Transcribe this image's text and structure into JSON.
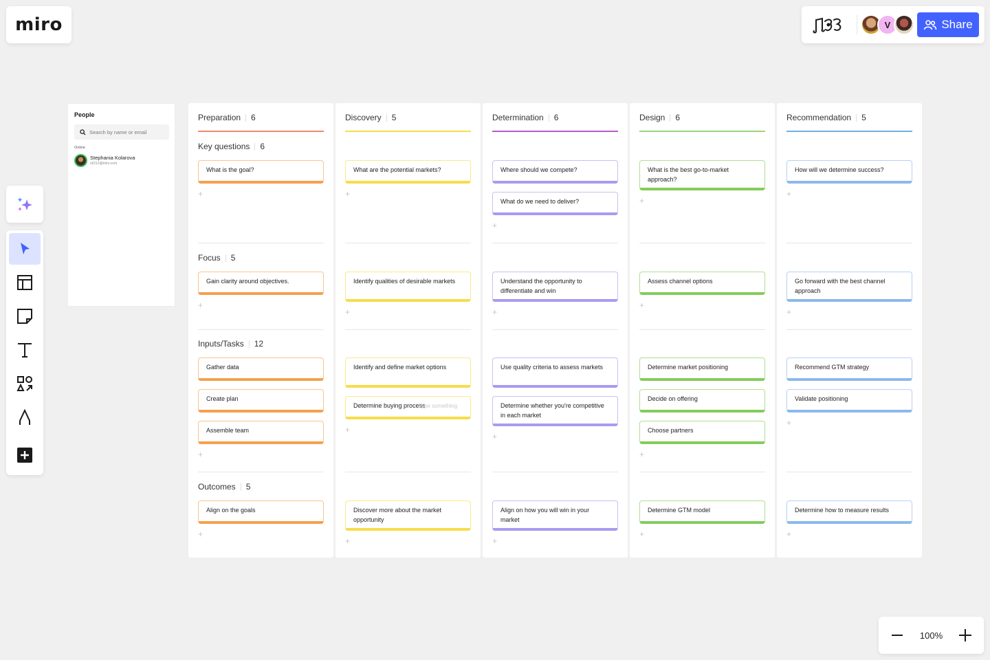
{
  "app": {
    "logo": "miro"
  },
  "header": {
    "share_label": "Share",
    "avatars": [
      {
        "type": "photo",
        "name": "collaborator-1"
      },
      {
        "type": "initial",
        "initial": "V"
      },
      {
        "type": "photo",
        "name": "collaborator-3"
      }
    ]
  },
  "people_panel": {
    "title": "People",
    "search_placeholder": "Search by name or email",
    "online_label": "Online",
    "people": [
      {
        "name": "Stephania Kolarova",
        "email": "s5212@miro.com"
      }
    ]
  },
  "toolbar": {
    "tools": [
      {
        "name": "select",
        "icon": "cursor-icon",
        "active": true
      },
      {
        "name": "templates",
        "icon": "layout-icon"
      },
      {
        "name": "sticky-note",
        "icon": "sticky-note-icon"
      },
      {
        "name": "text",
        "icon": "text-icon"
      },
      {
        "name": "shapes",
        "icon": "shapes-icon"
      },
      {
        "name": "pen",
        "icon": "pen-icon"
      },
      {
        "name": "more",
        "icon": "plus-square-icon"
      }
    ]
  },
  "zoom": {
    "value": "100%"
  },
  "colors": {
    "orange": "#f5a04f",
    "orange_light": "#fbc58d",
    "yellow": "#f8dc4a",
    "yellow_light": "#fbe88a",
    "purple": "#a99bf0",
    "purple_light": "#c9bff7",
    "green": "#84cc5a",
    "green_light": "#b1de94",
    "blue": "#8cb8ee",
    "blue_light": "#b5d2f5",
    "preparation_line": "#ee8a6b",
    "discovery_line": "#f8dc4a",
    "determination_line": "#b25cc8",
    "design_line": "#9bd47a",
    "recommendation_line": "#6fb0e4",
    "accent": "#4262ff"
  },
  "board": {
    "rows": [
      {
        "label": "Key questions",
        "count": "6"
      },
      {
        "label": "Focus",
        "count": "5"
      },
      {
        "label": "Inputs/Tasks",
        "count": "12"
      },
      {
        "label": "Outcomes",
        "count": "5"
      }
    ],
    "columns": [
      {
        "title": "Preparation",
        "count": "6",
        "cells": [
          [
            "What is the goal?"
          ],
          [
            "Gain clarity around objectives."
          ],
          [
            "Gather data",
            "Create plan",
            "Assemble team"
          ],
          [
            "Align on the goals"
          ]
        ]
      },
      {
        "title": "Discovery",
        "count": "5",
        "cells": [
          [
            "What are the potential markets?"
          ],
          [
            "Identify qualities of desirable markets"
          ],
          [
            "Identify and define market options",
            "Determine buying process"
          ],
          [
            "Discover more about the market opportunity"
          ]
        ],
        "ghost_text": "Type something"
      },
      {
        "title": "Determination",
        "count": "6",
        "cells": [
          [
            "Where should we compete?",
            "What do we need to deliver?"
          ],
          [
            "Understand the opportunity to differentiate and win"
          ],
          [
            "Use quality criteria to assess markets",
            "Determine whether you're competitive in each market"
          ],
          [
            "Align on how you will win in your market"
          ]
        ]
      },
      {
        "title": "Design",
        "count": "6",
        "cells": [
          [
            "What is the best go-to-market approach?"
          ],
          [
            "Assess channel options"
          ],
          [
            "Determine market positioning",
            "Decide on offering",
            "Choose partners"
          ],
          [
            "Determine GTM model"
          ]
        ]
      },
      {
        "title": "Recommendation",
        "count": "5",
        "cells": [
          [
            "How will we determine success?"
          ],
          [
            "Go forward with the best channel approach"
          ],
          [
            "Recommend GTM strategy",
            "Validate positioning"
          ],
          [
            "Determine how to measure results"
          ]
        ]
      }
    ]
  }
}
